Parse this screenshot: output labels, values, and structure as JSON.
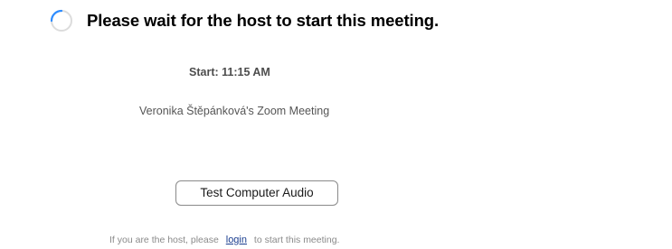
{
  "title": "Please wait for the host to start this meeting.",
  "start_time": "Start: 11:15 AM",
  "meeting_name": "Veronika Štěpánková's Zoom Meeting",
  "audio_button_label": "Test Computer Audio",
  "host_prompt": {
    "before": "If you are the host, please",
    "link": "login",
    "after": "to start this meeting."
  },
  "colors": {
    "spinner_ring": "#dcdcdc",
    "spinner_arc": "#2d8cff",
    "link": "#1a3d8f"
  },
  "icons": {
    "spinner": "loading-spinner-icon"
  }
}
